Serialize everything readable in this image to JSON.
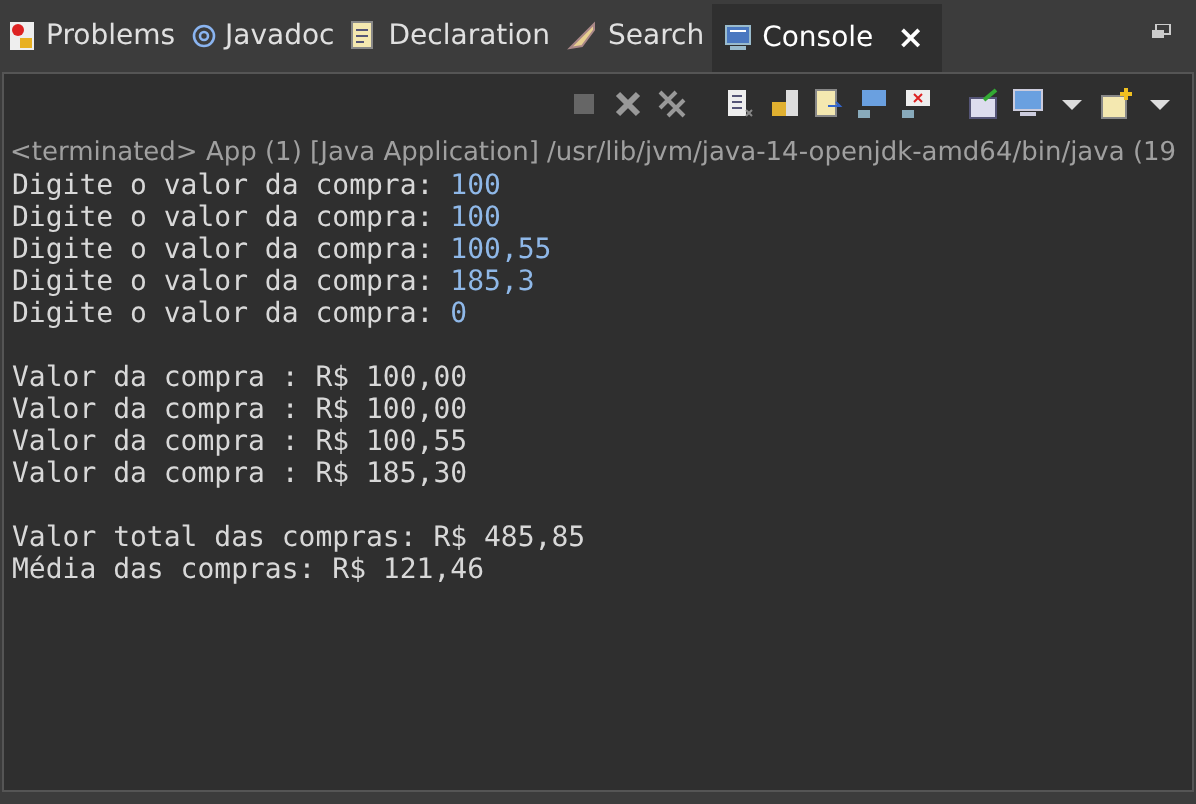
{
  "tabs": [
    {
      "label": "Problems",
      "selected": false
    },
    {
      "label": "Javadoc",
      "selected": false
    },
    {
      "label": "Declaration",
      "selected": false
    },
    {
      "label": "Search",
      "selected": false
    },
    {
      "label": "Console",
      "selected": true,
      "closable": true
    }
  ],
  "close_glyph": "×",
  "status_line": "<terminated> App (1) [Java Application] /usr/lib/jvm/java-14-openjdk-amd64/bin/java  (19",
  "console_lines": [
    {
      "kind": "io",
      "prompt": "Digite o valor da compra: ",
      "input": "100"
    },
    {
      "kind": "io",
      "prompt": "Digite o valor da compra: ",
      "input": "100"
    },
    {
      "kind": "io",
      "prompt": "Digite o valor da compra: ",
      "input": "100,55"
    },
    {
      "kind": "io",
      "prompt": "Digite o valor da compra: ",
      "input": "185,3"
    },
    {
      "kind": "io",
      "prompt": "Digite o valor da compra: ",
      "input": "0"
    },
    {
      "kind": "blank"
    },
    {
      "kind": "output",
      "text": "Valor da compra : R$ 100,00"
    },
    {
      "kind": "output",
      "text": "Valor da compra : R$ 100,00"
    },
    {
      "kind": "output",
      "text": "Valor da compra : R$ 100,55"
    },
    {
      "kind": "output",
      "text": "Valor da compra : R$ 185,30"
    },
    {
      "kind": "blank"
    },
    {
      "kind": "output",
      "text": "Valor total das compras: R$ 485,85"
    },
    {
      "kind": "output",
      "text": "Média das compras: R$ 121,46"
    }
  ]
}
